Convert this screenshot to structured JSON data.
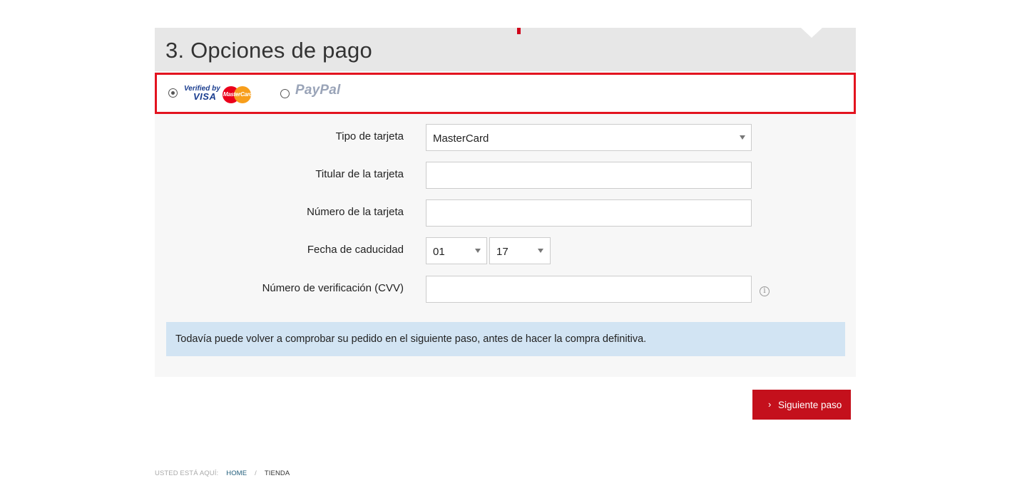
{
  "section": {
    "title": "3. Opciones de pago"
  },
  "payment_options": {
    "selected": "verified-by-visa-mastercard",
    "visa_verified_text": "Verified by",
    "visa_word": "VISA",
    "mastercard_text": "MasterCard",
    "paypal_text": "PayPal"
  },
  "form": {
    "card_type_label": "Tipo de tarjeta",
    "card_type_value": "MasterCard",
    "holder_label": "Titular de la tarjeta",
    "holder_value": "",
    "number_label": "Número de la tarjeta",
    "number_value": "",
    "expiry_label": "Fecha de caducidad",
    "expiry_month": "01",
    "expiry_year": "17",
    "cvv_label": "Número de verificación (CVV)",
    "cvv_value": "",
    "cvv_info_icon": "info-icon"
  },
  "notice": {
    "text": "Todavía puede volver a comprobar su pedido en el siguiente paso, antes de hacer la compra definitiva."
  },
  "actions": {
    "next_label": "Siguiente paso",
    "next_icon": "chevron-right-icon"
  },
  "breadcrumb": {
    "intro": "USTED ESTÁ AQUÍ:",
    "items": [
      "HOME",
      "TIENDA"
    ],
    "separator": "/"
  },
  "colors": {
    "accent_red": "#c4101c",
    "highlight_border": "#e3131f",
    "notice_bg": "#d2e4f3",
    "header_bg": "#e7e7e7"
  }
}
